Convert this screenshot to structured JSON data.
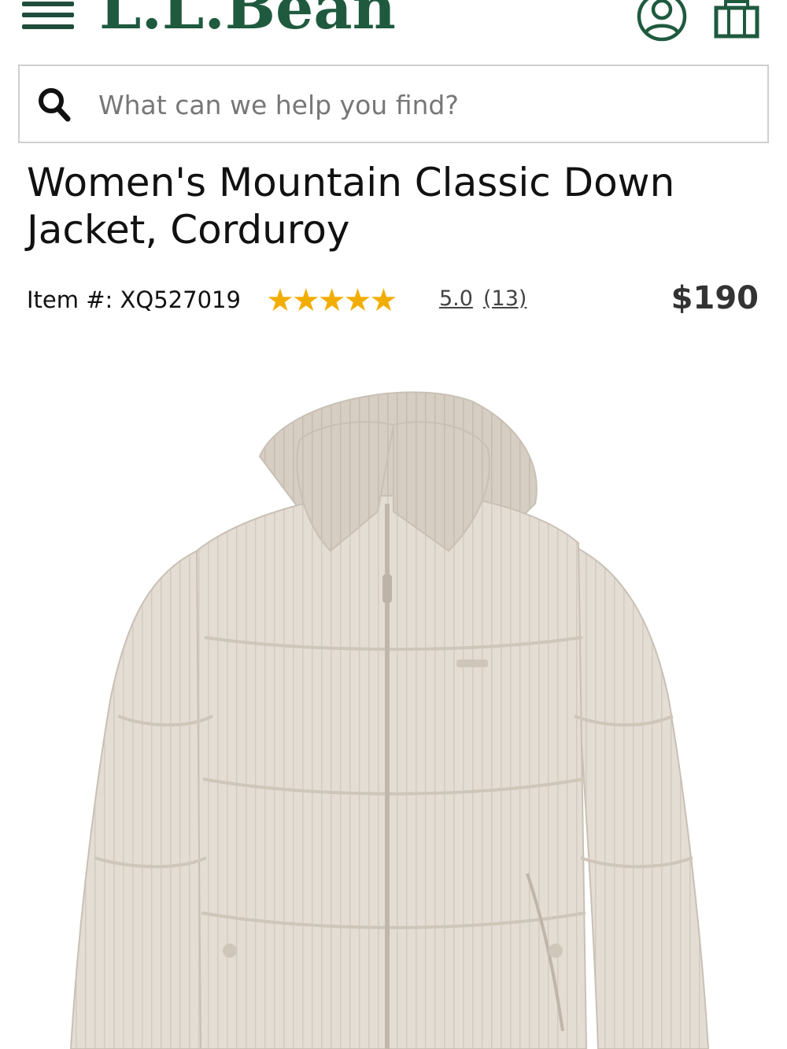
{
  "header": {
    "logo_text": "L.L.Bean",
    "brand_color": "#1f5a3f",
    "icons": [
      "menu-icon",
      "account-icon",
      "cart-icon"
    ]
  },
  "search": {
    "placeholder": "What can we help you find?",
    "value": ""
  },
  "product": {
    "title": "Women's Mountain Classic Down Jacket, Corduroy",
    "item_label": "Item #: XQ527019",
    "stars": "★★★★★",
    "rating": "5.0",
    "review_count": "(13)",
    "price": "$190",
    "star_color": "#f2ae00",
    "image_subject": "light beige corduroy hooded down puffer jacket"
  }
}
